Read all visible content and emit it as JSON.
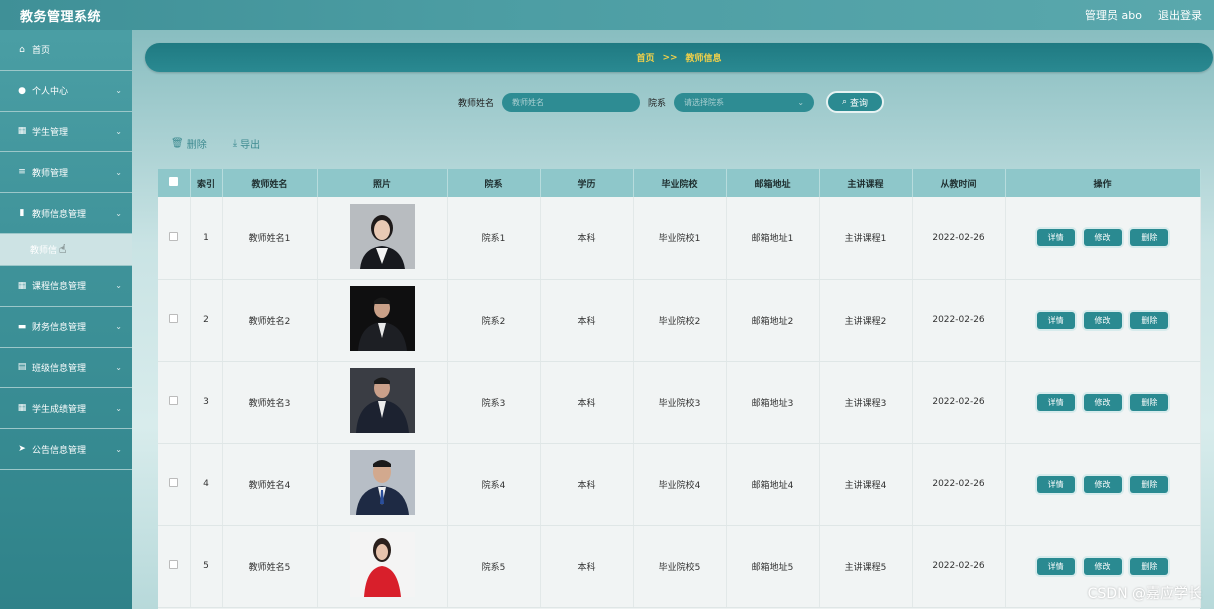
{
  "app_title": "教务管理系统",
  "top_right": {
    "admin_label": "管理员 abo",
    "logout_label": "退出登录"
  },
  "sidebar": {
    "items": [
      {
        "label": "首页",
        "icon": "home-icon",
        "has_chevron": false
      },
      {
        "label": "个人中心",
        "icon": "user-icon",
        "has_chevron": true
      },
      {
        "label": "学生管理",
        "icon": "grid-icon",
        "has_chevron": true
      },
      {
        "label": "教师管理",
        "icon": "list-icon",
        "has_chevron": true
      },
      {
        "label": "教师信息管理",
        "icon": "bar-chart-icon",
        "has_chevron": true
      },
      {
        "label": "课程信息管理",
        "icon": "grid-icon",
        "has_chevron": true
      },
      {
        "label": "财务信息管理",
        "icon": "monitor-icon",
        "has_chevron": true
      },
      {
        "label": "班级信息管理",
        "icon": "clipboard-icon",
        "has_chevron": true
      },
      {
        "label": "学生成绩管理",
        "icon": "grid-icon",
        "has_chevron": true
      },
      {
        "label": "公告信息管理",
        "icon": "send-icon",
        "has_chevron": true
      }
    ],
    "subitem": {
      "label": "教师信"
    }
  },
  "breadcrumb": {
    "home": "首页",
    "separator": ">>",
    "current": "教师信息"
  },
  "search": {
    "name_label": "教师姓名",
    "name_placeholder": "教师姓名",
    "dept_label": "院系",
    "dept_placeholder": "请选择院系",
    "button_label": "查询"
  },
  "actions": {
    "delete_label": "删除",
    "export_label": "导出"
  },
  "table": {
    "headers": [
      "索引",
      "教师姓名",
      "照片",
      "院系",
      "学历",
      "毕业院校",
      "邮箱地址",
      "主讲课程",
      "从教时间",
      "操作"
    ],
    "rows": [
      {
        "index": "1",
        "name": "教师姓名1",
        "dept": "院系1",
        "edu": "本科",
        "school": "毕业院校1",
        "email": "邮箱地址1",
        "course": "主讲课程1",
        "date": "2022-02-26"
      },
      {
        "index": "2",
        "name": "教师姓名2",
        "dept": "院系2",
        "edu": "本科",
        "school": "毕业院校2",
        "email": "邮箱地址2",
        "course": "主讲课程2",
        "date": "2022-02-26"
      },
      {
        "index": "3",
        "name": "教师姓名3",
        "dept": "院系3",
        "edu": "本科",
        "school": "毕业院校3",
        "email": "邮箱地址3",
        "course": "主讲课程3",
        "date": "2022-02-26"
      },
      {
        "index": "4",
        "name": "教师姓名4",
        "dept": "院系4",
        "edu": "本科",
        "school": "毕业院校4",
        "email": "邮箱地址4",
        "course": "主讲课程4",
        "date": "2022-02-26"
      },
      {
        "index": "5",
        "name": "教师姓名5",
        "dept": "院系5",
        "edu": "本科",
        "school": "毕业院校5",
        "email": "邮箱地址5",
        "course": "主讲课程5",
        "date": "2022-02-26"
      }
    ],
    "op_labels": {
      "detail": "详情",
      "edit": "修改",
      "delete": "删除"
    }
  },
  "watermark": "CSDN @嘉应学长",
  "colors": {
    "accent": "#2a8a91",
    "header_bg": "#8ec7ca",
    "breadcrumb_text": "#f0d04a"
  }
}
